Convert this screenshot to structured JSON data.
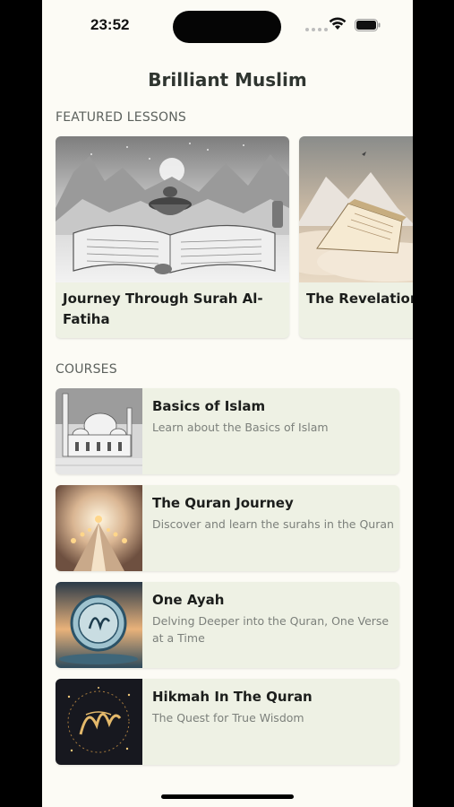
{
  "status_bar": {
    "time": "23:52",
    "icons": [
      "signal-icon",
      "wifi-icon",
      "battery-icon"
    ]
  },
  "app": {
    "title": "Brilliant Muslim"
  },
  "featured": {
    "label": "FEATURED LESSONS",
    "items": [
      {
        "title": "Journey Through Surah Al-Fatiha",
        "image": "open-quran-mountains-image"
      },
      {
        "title": "The Revelation",
        "image": "quran-on-clouds-image"
      }
    ]
  },
  "courses": {
    "label": "COURSES",
    "items": [
      {
        "title": "Basics of Islam",
        "description": "Learn about the Basics of Islam",
        "image": "mosque-sketch-image"
      },
      {
        "title": "The Quran Journey",
        "description": "Discover and learn the surahs in the Quran",
        "image": "lantern-path-image"
      },
      {
        "title": "One Ayah",
        "description": "Delving Deeper into the Quran, One Verse at a Time",
        "image": "calligraphy-medallion-image"
      },
      {
        "title": "Hikmah In The Quran",
        "description": "The Quest for True Wisdom",
        "image": "golden-calligraphy-image"
      }
    ]
  },
  "colors": {
    "background": "#fcfbf5",
    "card": "#eef1e4",
    "title_text": "#1c1e1c",
    "muted_text": "#7c807b"
  }
}
